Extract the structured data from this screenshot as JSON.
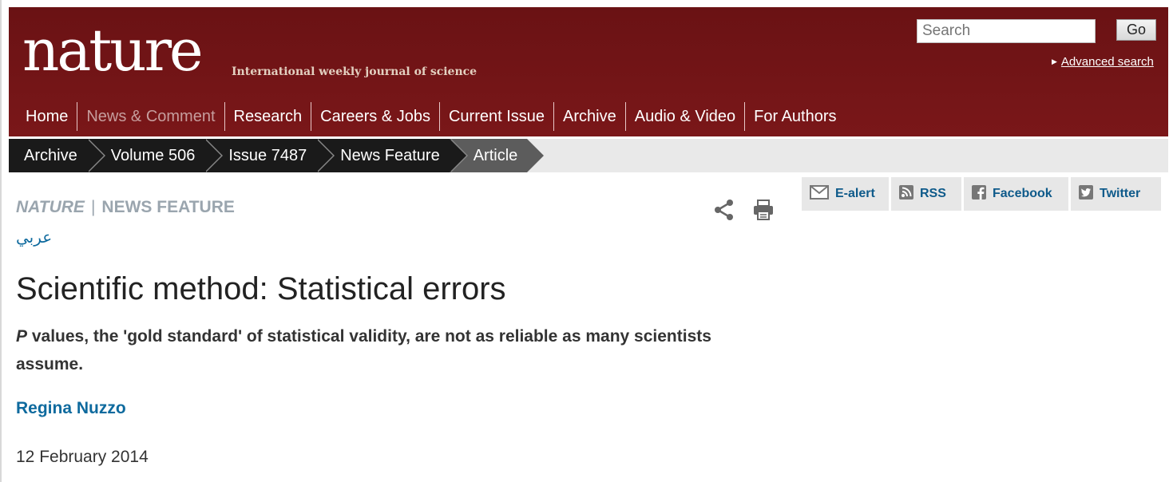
{
  "header": {
    "logo": "nature",
    "tagline": "International weekly journal of science",
    "search_placeholder": "Search",
    "go_label": "Go",
    "advanced_search": "Advanced search"
  },
  "nav": {
    "items": [
      {
        "label": "Home"
      },
      {
        "label": "News & Comment",
        "muted": true
      },
      {
        "label": "Research"
      },
      {
        "label": "Careers & Jobs"
      },
      {
        "label": "Current Issue"
      },
      {
        "label": "Archive"
      },
      {
        "label": "Audio & Video"
      },
      {
        "label": "For Authors"
      }
    ]
  },
  "breadcrumb": [
    "Archive",
    "Volume 506",
    "Issue 7487",
    "News Feature",
    "Article"
  ],
  "social": {
    "ealert": "E-alert",
    "rss": "RSS",
    "facebook": "Facebook",
    "twitter": "Twitter"
  },
  "article": {
    "journal": "NATURE",
    "separator": "|",
    "section": "NEWS FEATURE",
    "language_link": "عربي",
    "title": "Scientific method: Statistical errors",
    "standfirst_italic": "P",
    "standfirst_rest": " values, the 'gold standard' of statistical validity, are not as reliable as many scientists assume.",
    "author": "Regina Nuzzo",
    "date": "12 February 2014"
  },
  "colors": {
    "header_bg": "#6e1214",
    "link_blue": "#0e6a9e",
    "section_gray": "#9aa5ae"
  }
}
